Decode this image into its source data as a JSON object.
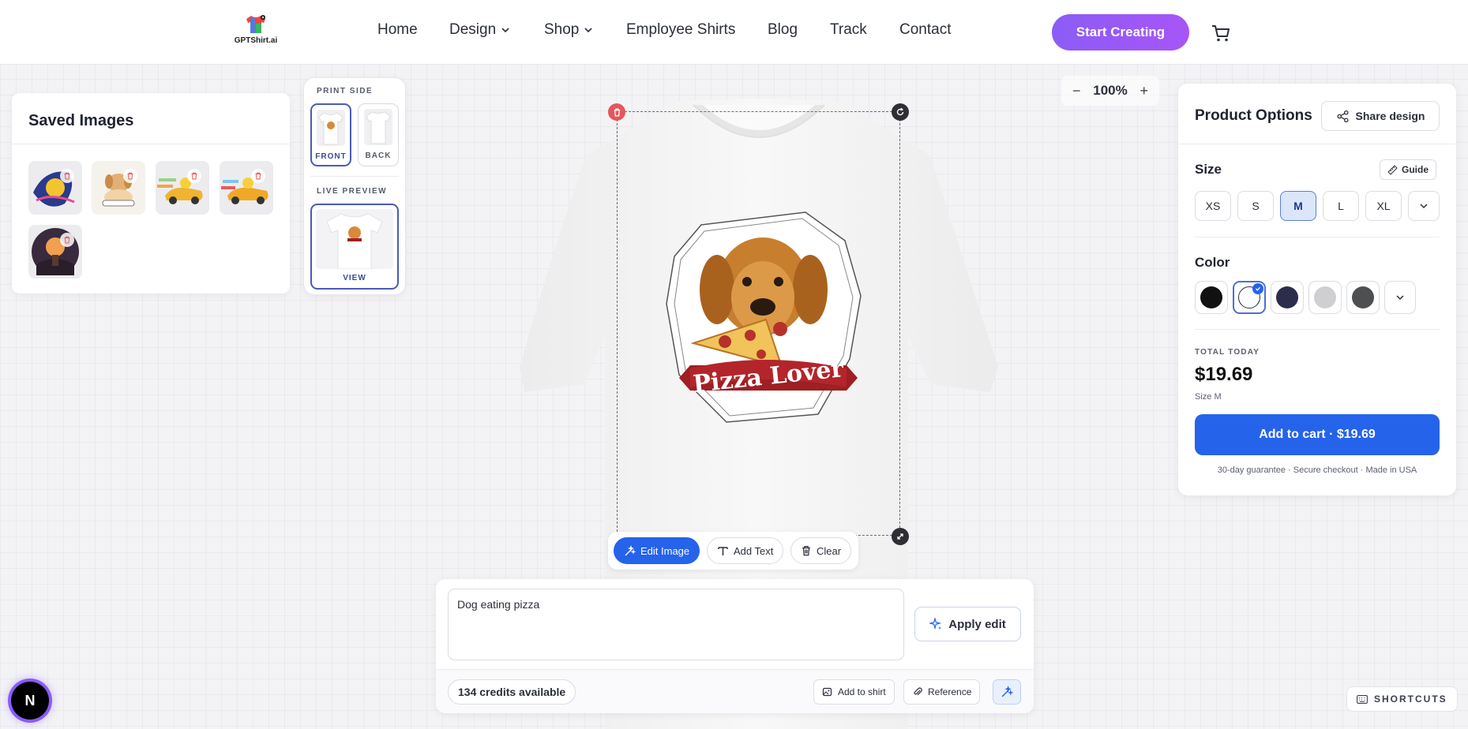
{
  "brand": {
    "name": "GPTShirt.ai"
  },
  "nav": {
    "items": [
      {
        "label": "Home",
        "dropdown": false
      },
      {
        "label": "Design",
        "dropdown": true
      },
      {
        "label": "Shop",
        "dropdown": true
      },
      {
        "label": "Employee Shirts",
        "dropdown": false
      },
      {
        "label": "Blog",
        "dropdown": false
      },
      {
        "label": "Track",
        "dropdown": false
      },
      {
        "label": "Contact",
        "dropdown": false
      }
    ],
    "cta_label": "Start Creating",
    "cart_icon": "cart-icon"
  },
  "saved_images": {
    "title": "Saved Images",
    "items": [
      {
        "name": "pikachu-swirl"
      },
      {
        "name": "puppy-sticker"
      },
      {
        "name": "pikachu-car-1"
      },
      {
        "name": "pikachu-car-2"
      },
      {
        "name": "fantasy-scene"
      }
    ]
  },
  "print_side": {
    "label": "PRINT SIDE",
    "front_label": "FRONT",
    "back_label": "BACK",
    "selected": "FRONT",
    "live_preview_label": "LIVE PREVIEW",
    "view_label": "VIEW"
  },
  "canvas": {
    "zoom": "100%",
    "zoom_minus": "−",
    "zoom_plus": "+",
    "design_banner_text": "Pizza Lover"
  },
  "toolbar": {
    "edit_image": "Edit Image",
    "add_text": "Add Text",
    "clear": "Clear"
  },
  "prompt": {
    "value": "Dog eating pizza",
    "apply_label": "Apply edit",
    "credits": "134 credits available",
    "add_to_shirt": "Add to shirt",
    "reference": "Reference"
  },
  "product_options": {
    "title": "Product Options",
    "share_label": "Share design",
    "size_label": "Size",
    "guide_label": "Guide",
    "sizes": [
      "XS",
      "S",
      "M",
      "L",
      "XL"
    ],
    "selected_size": "M",
    "color_label": "Color",
    "colors": [
      "#111111",
      "#ffffff",
      "#2b2d4a",
      "#cfcfd2",
      "#4d4f50"
    ],
    "selected_color": "#ffffff",
    "total_label": "TOTAL TODAY",
    "price": "$19.69",
    "size_note": "Size M",
    "add_to_cart": "Add to cart · $19.69",
    "guarantee": "30-day guarantee · Secure checkout · Made in USA"
  },
  "misc": {
    "avatar_letter": "N",
    "shortcuts": "SHORTCUTS"
  },
  "theme": {
    "accent": "#2563eb",
    "cta_gradient_start": "#8b5cf6",
    "cta_gradient_end": "#a855f7",
    "danger": "#e4575b"
  }
}
